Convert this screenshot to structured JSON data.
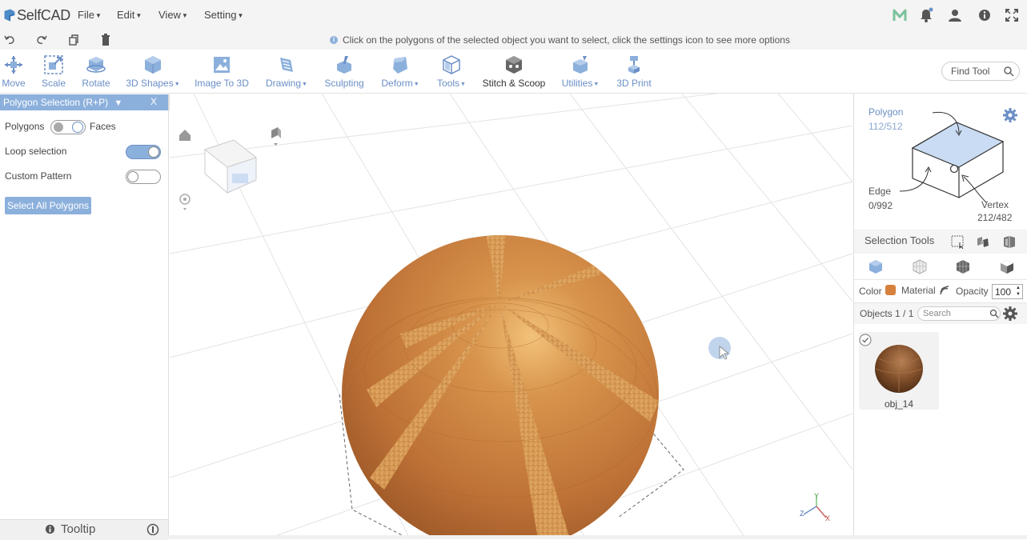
{
  "app": {
    "name": "SelfCAD"
  },
  "menu": [
    "File",
    "Edit",
    "View",
    "Setting"
  ],
  "hint": "Click on the polygons of the selected object you want to select, click the settings icon to see more options",
  "toolbar": {
    "tools": [
      {
        "label": "Move",
        "icon": "move-icon",
        "dropdown": false
      },
      {
        "label": "Scale",
        "icon": "scale-icon",
        "dropdown": false
      },
      {
        "label": "Rotate",
        "icon": "rotate-icon",
        "dropdown": false
      },
      {
        "label": "3D Shapes",
        "icon": "cube-icon",
        "dropdown": true
      },
      {
        "label": "Image To 3D",
        "icon": "image-icon",
        "dropdown": false
      },
      {
        "label": "Drawing",
        "icon": "drawing-icon",
        "dropdown": true
      },
      {
        "label": "Sculpting",
        "icon": "sculpting-icon",
        "dropdown": false
      },
      {
        "label": "Deform",
        "icon": "deform-icon",
        "dropdown": true
      },
      {
        "label": "Tools",
        "icon": "tools-icon",
        "dropdown": true
      },
      {
        "label": "Stitch & Scoop",
        "icon": "stitch-icon",
        "dropdown": false
      },
      {
        "label": "Utilities",
        "icon": "utilities-icon",
        "dropdown": true
      },
      {
        "label": "3D Print",
        "icon": "printer-icon",
        "dropdown": false
      }
    ],
    "find_tool_placeholder": "Find Tool"
  },
  "left_panel": {
    "title": "Polygon Selection (R+P)",
    "close": "X",
    "mode_left": "Polygons",
    "mode_right": "Faces",
    "loop_selection": "Loop selection",
    "custom_pattern": "Custom Pattern",
    "select_all": "Select All Polygons",
    "tooltip": "Tooltip"
  },
  "right_panel": {
    "polygon_label": "Polygon",
    "polygon_count": "112/512",
    "edge_label": "Edge",
    "edge_count": "0/992",
    "vertex_label": "Vertex",
    "vertex_count": "212/482",
    "selection_tools": "Selection Tools",
    "color_label": "Color",
    "material_label": "Material",
    "opacity_label": "Opacity",
    "opacity_value": "100",
    "objects_label": "Objects 1 / 1",
    "search_placeholder": "Search",
    "object_name": "obj_14"
  },
  "axes": {
    "x": "X",
    "y": "Y",
    "z": "Z"
  },
  "colors": {
    "accent": "#8cb0dc",
    "accent_text": "#6b8fc6",
    "object": "#c57a3a"
  }
}
